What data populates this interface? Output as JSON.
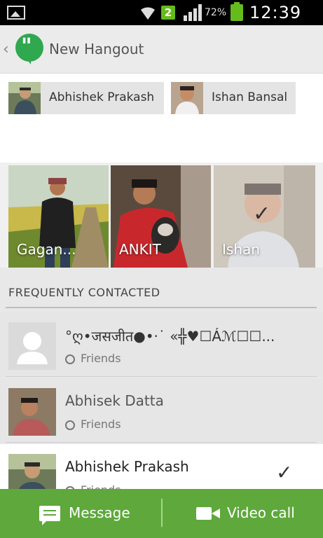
{
  "status_bar": {
    "notification_badge": "2",
    "battery_percent": "72%",
    "time": "12:39 PM"
  },
  "action_bar": {
    "title": "New Hangout"
  },
  "selected_chips": [
    {
      "name": "Abhishek Prakash"
    },
    {
      "name": "Ishan Bansal"
    }
  ],
  "suggested_tiles": [
    {
      "name": "Gagan..."
    },
    {
      "name": "ANKIT"
    },
    {
      "name": "Ishan",
      "checked": true
    }
  ],
  "frequently_contacted": {
    "title": "FREQUENTLY CONTACTED",
    "contacts": [
      {
        "name": "°ღ•जसजीत●•·˙ «╬♥☐Áℳ☐☐...",
        "group": "Friends"
      },
      {
        "name": "Abhisek Datta",
        "group": "Friends"
      },
      {
        "name": "Abhishek Prakash",
        "group": "Friends",
        "checked": true
      }
    ]
  },
  "bottom_bar": {
    "message_label": "Message",
    "video_label": "Video call"
  },
  "colors": {
    "accent_green": "#5ea83c",
    "hangout_logo": "#2fa84f"
  }
}
